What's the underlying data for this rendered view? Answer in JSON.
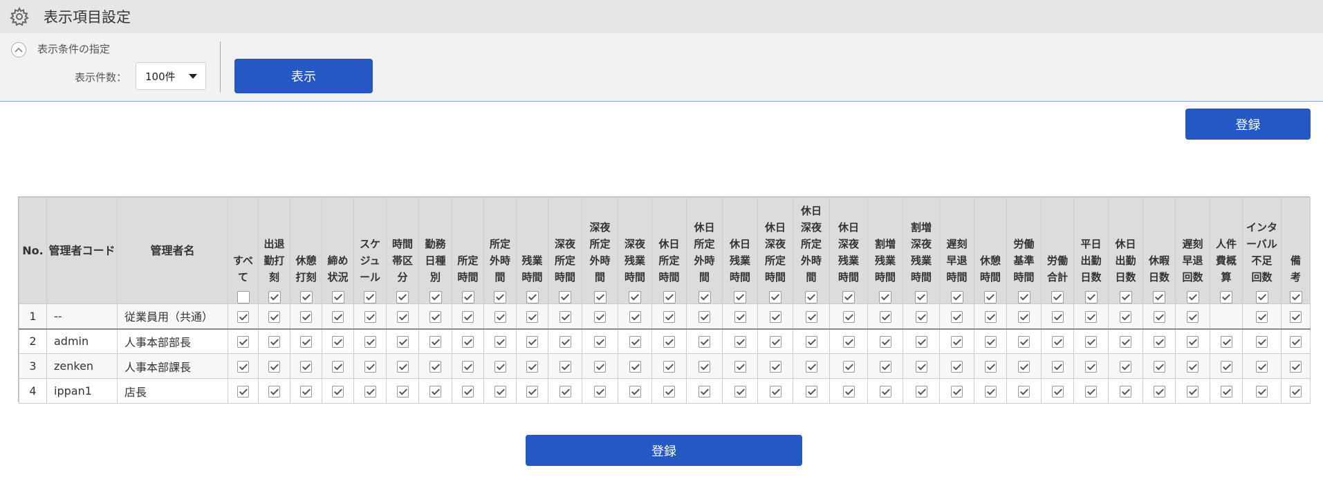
{
  "header": {
    "title": "表示項目設定",
    "icon": "gear-icon"
  },
  "conditions": {
    "label": "表示条件の指定",
    "count_label": "表示件数：",
    "count_value": "100件",
    "show_button": "表示"
  },
  "register_top": "登録",
  "register_bottom": "登録",
  "table": {
    "fixed_headers": [
      "No.",
      "管理者コード",
      "管理者名"
    ],
    "columns": [
      [
        "すべ",
        "て"
      ],
      [
        "出退",
        "勤打",
        "刻"
      ],
      [
        "休憩",
        "打刻"
      ],
      [
        "締め",
        "状況"
      ],
      [
        "スケ",
        "ジュ",
        "ール"
      ],
      [
        "時間",
        "帯区",
        "分"
      ],
      [
        "勤務",
        "日種",
        "別"
      ],
      [
        "所定",
        "時間"
      ],
      [
        "所定",
        "外時",
        "間"
      ],
      [
        "残業",
        "時間"
      ],
      [
        "深夜",
        "所定",
        "時間"
      ],
      [
        "深夜",
        "所定",
        "外時",
        "間"
      ],
      [
        "深夜",
        "残業",
        "時間"
      ],
      [
        "休日",
        "所定",
        "時間"
      ],
      [
        "休日",
        "所定",
        "外時",
        "間"
      ],
      [
        "休日",
        "残業",
        "時間"
      ],
      [
        "休日",
        "深夜",
        "所定",
        "時間"
      ],
      [
        "休日",
        "深夜",
        "所定",
        "外時",
        "間"
      ],
      [
        "休日",
        "深夜",
        "残業",
        "時間"
      ],
      [
        "割増",
        "残業",
        "時間"
      ],
      [
        "割増",
        "深夜",
        "残業",
        "時間"
      ],
      [
        "遅刻",
        "早退",
        "時間"
      ],
      [
        "休憩",
        "時間"
      ],
      [
        "労働",
        "基準",
        "時間"
      ],
      [
        "労働",
        "合計"
      ],
      [
        "平日",
        "出勤",
        "日数"
      ],
      [
        "休日",
        "出勤",
        "日数"
      ],
      [
        "休暇",
        "日数"
      ],
      [
        "遅刻",
        "早退",
        "回数"
      ],
      [
        "人件",
        "費概",
        "算"
      ],
      [
        "インタ",
        "ーバル",
        "不足",
        "回数"
      ],
      [
        "備",
        "考"
      ]
    ],
    "header_checks": [
      false,
      true,
      true,
      true,
      true,
      true,
      true,
      true,
      true,
      true,
      true,
      true,
      true,
      true,
      true,
      true,
      true,
      true,
      true,
      true,
      true,
      true,
      true,
      true,
      true,
      true,
      true,
      true,
      true,
      true,
      true,
      true
    ],
    "rows": [
      {
        "no": "1",
        "code": "--",
        "name": "従業員用（共通）",
        "checks": [
          true,
          true,
          true,
          true,
          true,
          true,
          true,
          true,
          true,
          true,
          true,
          true,
          true,
          true,
          true,
          true,
          true,
          true,
          true,
          true,
          true,
          true,
          true,
          true,
          true,
          true,
          true,
          true,
          true,
          null,
          true,
          true
        ]
      },
      {
        "no": "2",
        "code": "admin",
        "name": "人事本部部長",
        "checks": [
          true,
          true,
          true,
          true,
          true,
          true,
          true,
          true,
          true,
          true,
          true,
          true,
          true,
          true,
          true,
          true,
          true,
          true,
          true,
          true,
          true,
          true,
          true,
          true,
          true,
          true,
          true,
          true,
          true,
          true,
          true,
          true
        ]
      },
      {
        "no": "3",
        "code": "zenken",
        "name": "人事本部課長",
        "checks": [
          true,
          true,
          true,
          true,
          true,
          true,
          true,
          true,
          true,
          true,
          true,
          true,
          true,
          true,
          true,
          true,
          true,
          true,
          true,
          true,
          true,
          true,
          true,
          true,
          true,
          true,
          true,
          true,
          true,
          true,
          true,
          true
        ]
      },
      {
        "no": "4",
        "code": "ippan1",
        "name": "店長",
        "checks": [
          true,
          true,
          true,
          true,
          true,
          true,
          true,
          true,
          true,
          true,
          true,
          true,
          true,
          true,
          true,
          true,
          true,
          true,
          true,
          true,
          true,
          true,
          true,
          true,
          true,
          true,
          true,
          true,
          true,
          true,
          true,
          true
        ]
      }
    ]
  }
}
